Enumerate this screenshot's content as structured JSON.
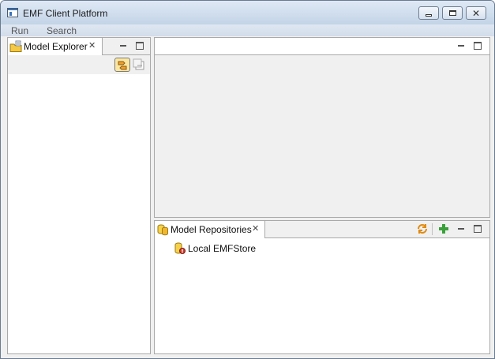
{
  "window": {
    "title": "EMF Client Platform",
    "controls": {
      "minimize": "minimize-icon",
      "maximize": "restore-icon",
      "close": "close-icon"
    }
  },
  "menu": {
    "items": [
      "Run",
      "Search"
    ]
  },
  "model_explorer": {
    "tab_label": "Model Explorer",
    "toolbar": [
      "link-with-editor-icon",
      "collapse-all-icon"
    ]
  },
  "model_repositories": {
    "tab_label": "Model Repositories",
    "toolbar": [
      "refresh-icon",
      "add-repository-icon"
    ],
    "items": [
      {
        "label": "Local EMFStore"
      }
    ]
  },
  "colors": {
    "titlebar": "#c3d4e7",
    "menubar": "#d2ddeb",
    "view_border": "#a9a9a9",
    "panel_bg": "#f0f0f0"
  }
}
